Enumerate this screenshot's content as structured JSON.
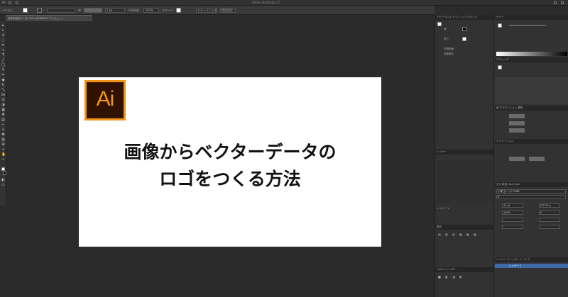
{
  "window": {
    "app_logo": "Ai",
    "title": "Adobe Illustrator CC"
  },
  "controlbar": {
    "selection_state": "パスなし",
    "stroke_label": "線",
    "stroke_value": "1 pt",
    "stroke_style": "均等",
    "opacity_label": "不透明度",
    "opacity_value": "100%",
    "style_label": "スタイル",
    "document_setup": "ドキュメント設定",
    "preferences": "環境設定"
  },
  "document_tab": {
    "label": "名称未設定-1* @ 100% (RGB/GPU プレビュー)"
  },
  "artboard": {
    "logo_text": "Ai",
    "headline_line1": "画像からベクターデータの",
    "headline_line2": "ロゴをつくる方法"
  },
  "panels": {
    "col1_tabs": [
      "アピアランス",
      "グラフィックスタイル"
    ],
    "col1_items": [
      "パス",
      "線",
      "塗り",
      "不透明度",
      "初期設定"
    ],
    "col1_layers_tab": "レイヤー",
    "col1_layer_name": "レイヤー 1",
    "col1_align_tab": "整列",
    "col1_pathfinder_tab": "パスファインダー",
    "col2_color_tab": "カラー",
    "col2_swatches_tab": "スウォッチ",
    "col2_stroke_tab": "線",
    "col2_gradient_tab": "グラデーション",
    "col2_transparency_tab": "透明",
    "col2_char_tabs": [
      "文字",
      "段落",
      "OpenType"
    ],
    "col2_font": "小塚ゴシック Pr6N",
    "col2_font_style": "R",
    "col2_size": "12 pt",
    "col2_leading": "(20.75 p",
    "col2_tracking": "100%",
    "col2_kerning": "0",
    "col2_bottom_tabs": [
      "レイヤー",
      "アートボード",
      "リンク"
    ],
    "col2_layer_name": "レイヤー 1"
  },
  "colors": {
    "accent_orange": "#f29418",
    "logo_bg": "#2f1200",
    "selection_blue": "#3e6aa8"
  }
}
